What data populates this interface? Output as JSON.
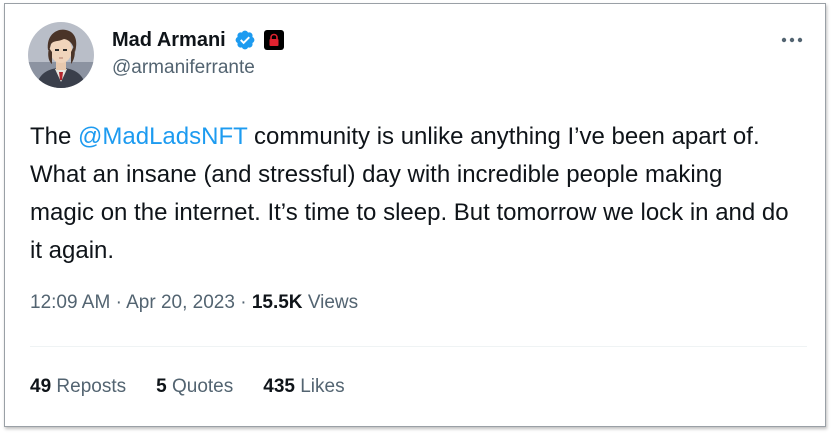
{
  "author": {
    "name": "Mad Armani",
    "handle": "@armaniferrante"
  },
  "tweet": {
    "text_before": "The ",
    "mention": "@MadLadsNFT",
    "text_after": " community is unlike anything I’ve been apart of. What an insane (and stressful) day with incredible people making magic on the internet. It’s time to sleep. But tomorrow we lock in and do it again."
  },
  "meta": {
    "time": "12:09 AM",
    "separator": "·",
    "date": "Apr 20, 2023",
    "views_count": "15.5K",
    "views_label": "Views"
  },
  "engagement": {
    "reposts_count": "49",
    "reposts_label": "Reposts",
    "quotes_count": "5",
    "quotes_label": "Quotes",
    "likes_count": "435",
    "likes_label": "Likes"
  },
  "icons": {
    "verified": "verified-badge-icon",
    "affiliate": "affiliate-badge-icon",
    "more": "more-options-icon"
  },
  "colors": {
    "accent": "#1d9bf0",
    "text": "#0f1419",
    "secondary_text": "#536471",
    "badge_red": "#e0222f"
  }
}
